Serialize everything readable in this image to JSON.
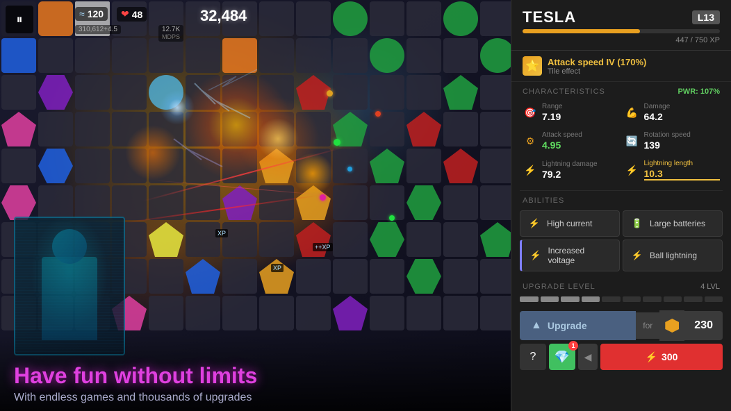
{
  "game": {
    "score": "32,484",
    "wave": "120",
    "hearts": "48",
    "stars": "310,612+4.5",
    "mdps": "12.7K",
    "bottom_title": "Have fun without limits",
    "bottom_subtitle": "With endless games and thousands of upgrades"
  },
  "panel": {
    "tower_name": "TESLA",
    "level": "L13",
    "xp_current": "447",
    "xp_max": "750",
    "xp_label": "447 / 750 XP",
    "xp_percent": 59.6,
    "tile_effect_name": "Attack speed IV (170%)",
    "tile_effect_sub": "Tile effect",
    "section_chars": "CHARACTERISTICS",
    "pwr": "PWR: 107%",
    "chars": [
      {
        "label": "Range",
        "value": "7.19",
        "icon": "🎯"
      },
      {
        "label": "Damage",
        "value": "64.2",
        "icon": "💥"
      },
      {
        "label": "Attack speed",
        "value": "4.95",
        "icon": "⚙️",
        "highlighted": false
      },
      {
        "label": "Rotation speed",
        "value": "139",
        "icon": "🔄"
      },
      {
        "label": "Lightning damage",
        "value": "79.2",
        "icon": "⚡"
      },
      {
        "label": "Lightning length",
        "value": "10.3",
        "icon": "⚡",
        "highlighted": true
      }
    ],
    "section_abilities": "ABILITIES",
    "abilities": [
      {
        "name": "High current",
        "icon": "⚡",
        "type": "normal"
      },
      {
        "name": "Large batteries",
        "icon": "🔋",
        "type": "normal"
      },
      {
        "name": "Increased voltage",
        "icon": "⚡",
        "type": "voltage"
      },
      {
        "name": "Ball lightning",
        "icon": "⚡",
        "type": "lightning"
      }
    ],
    "section_upgrade": "UPGRADE LEVEL",
    "upgrade_level": "4 LVL",
    "upgrade_pips": [
      true,
      true,
      true,
      true,
      false,
      false,
      false,
      false,
      false,
      false
    ],
    "upgrade_label": "Upgrade",
    "for_label": "for",
    "cost": "230",
    "bottom_buttons": {
      "info": "?",
      "gem_count": "1",
      "bluetooth_cost": "300"
    }
  },
  "icons": {
    "pause": "⏸",
    "wave": "≈",
    "heart": "❤",
    "star": "★",
    "upgrade_arrow": "▲",
    "arrow_right": "▶",
    "arrow_left": "◀",
    "bluetooth": "⚡",
    "coin": "◆"
  }
}
